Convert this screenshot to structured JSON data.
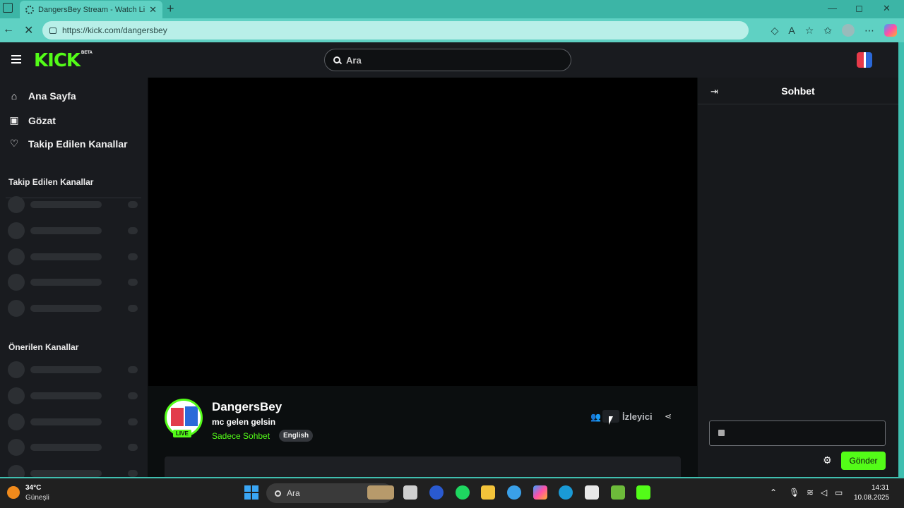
{
  "browser": {
    "tab_title": "DangersBey Stream - Watch Live",
    "tab_close": "✕",
    "new_tab": "+",
    "url": "https://kick.com/dangersbey",
    "window_controls": [
      "—",
      "◻",
      "✕"
    ]
  },
  "site": {
    "logo": "KICK",
    "logo_badge": "BETA",
    "search_placeholder": "Ara"
  },
  "sidebar": {
    "nav": [
      {
        "label": "Ana Sayfa",
        "icon": "⌂"
      },
      {
        "label": "Gözat",
        "icon": "▣"
      },
      {
        "label": "Takip Edilen Kanallar",
        "icon": "♡"
      }
    ],
    "section_followed": "Takip Edilen Kanallar",
    "section_recommended": "Önerilen Kanallar"
  },
  "channel": {
    "name": "DangersBey",
    "title": "mc gelen gelsin",
    "category": "Sadece Sohbet",
    "language": "English",
    "live_badge": "LIVE",
    "viewer_label": "İzleyici"
  },
  "chat": {
    "title": "Sohbet",
    "send_label": "Gönder"
  },
  "taskbar": {
    "temperature": "34°C",
    "weather": "Güneşli",
    "search_placeholder": "Ara",
    "time": "14:31",
    "date": "10.08.2025"
  },
  "colors": {
    "brand": "#53fc18",
    "page_bg": "#0b0e0f",
    "panel_bg": "#191b1f"
  }
}
